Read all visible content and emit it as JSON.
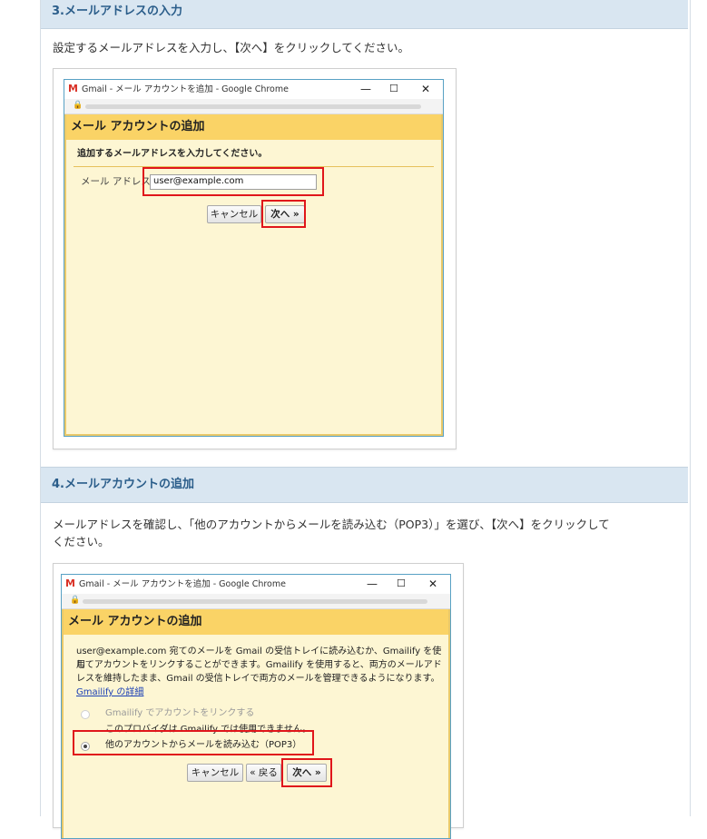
{
  "section3": {
    "heading": "3.メールアドレスの入力",
    "description": "設定するメールアドレスを入力し、【次へ】をクリックしてください。",
    "window": {
      "title": "Gmail - メール アカウントを追加 - Google Chrome",
      "dialog_title": "メール アカウントの追加",
      "instruction": "追加するメールアドレスを入力してください。",
      "email_label": "メール アドレス:",
      "email_value": "user@example.com",
      "cancel_label": "キャンセル",
      "next_label": "次へ »"
    }
  },
  "section4": {
    "heading": "4.メールアカウントの追加",
    "description_line1": "メールアドレスを確認し、「他のアカウントからメールを読み込む（POP3）」を選び、【次へ】をクリックして",
    "description_line2": "ください。",
    "window": {
      "title": "Gmail - メール アカウントを追加 - Google Chrome",
      "dialog_title": "メール アカウントの追加",
      "body_line1": "user@example.com 宛てのメールを Gmail の受信トレイに読み込むか、Gmailify を使用",
      "body_line2": "してアカウントをリンクすることができます。Gmailify を使用すると、両方のメールアド",
      "body_line3": "レスを維持したまま、Gmail の受信トレイで両方のメールを管理できるようになります。",
      "details_link": "Gmailify の詳細",
      "option_gmailify": "Gmailify でアカウントをリンクする",
      "option_gmailify_note": "このプロバイダは Gmailify では使用できません。",
      "option_pop3": "他のアカウントからメールを読み込む（POP3）",
      "cancel_label": "キャンセル",
      "back_label": "« 戻る",
      "next_label": "次へ »"
    }
  },
  "window_controls": {
    "minimize": "—",
    "maximize": "☐",
    "close": "✕"
  },
  "colors": {
    "accent_red": "#e0161b",
    "dialog_header": "#fad366",
    "section_heading": "#d9e6f1"
  }
}
